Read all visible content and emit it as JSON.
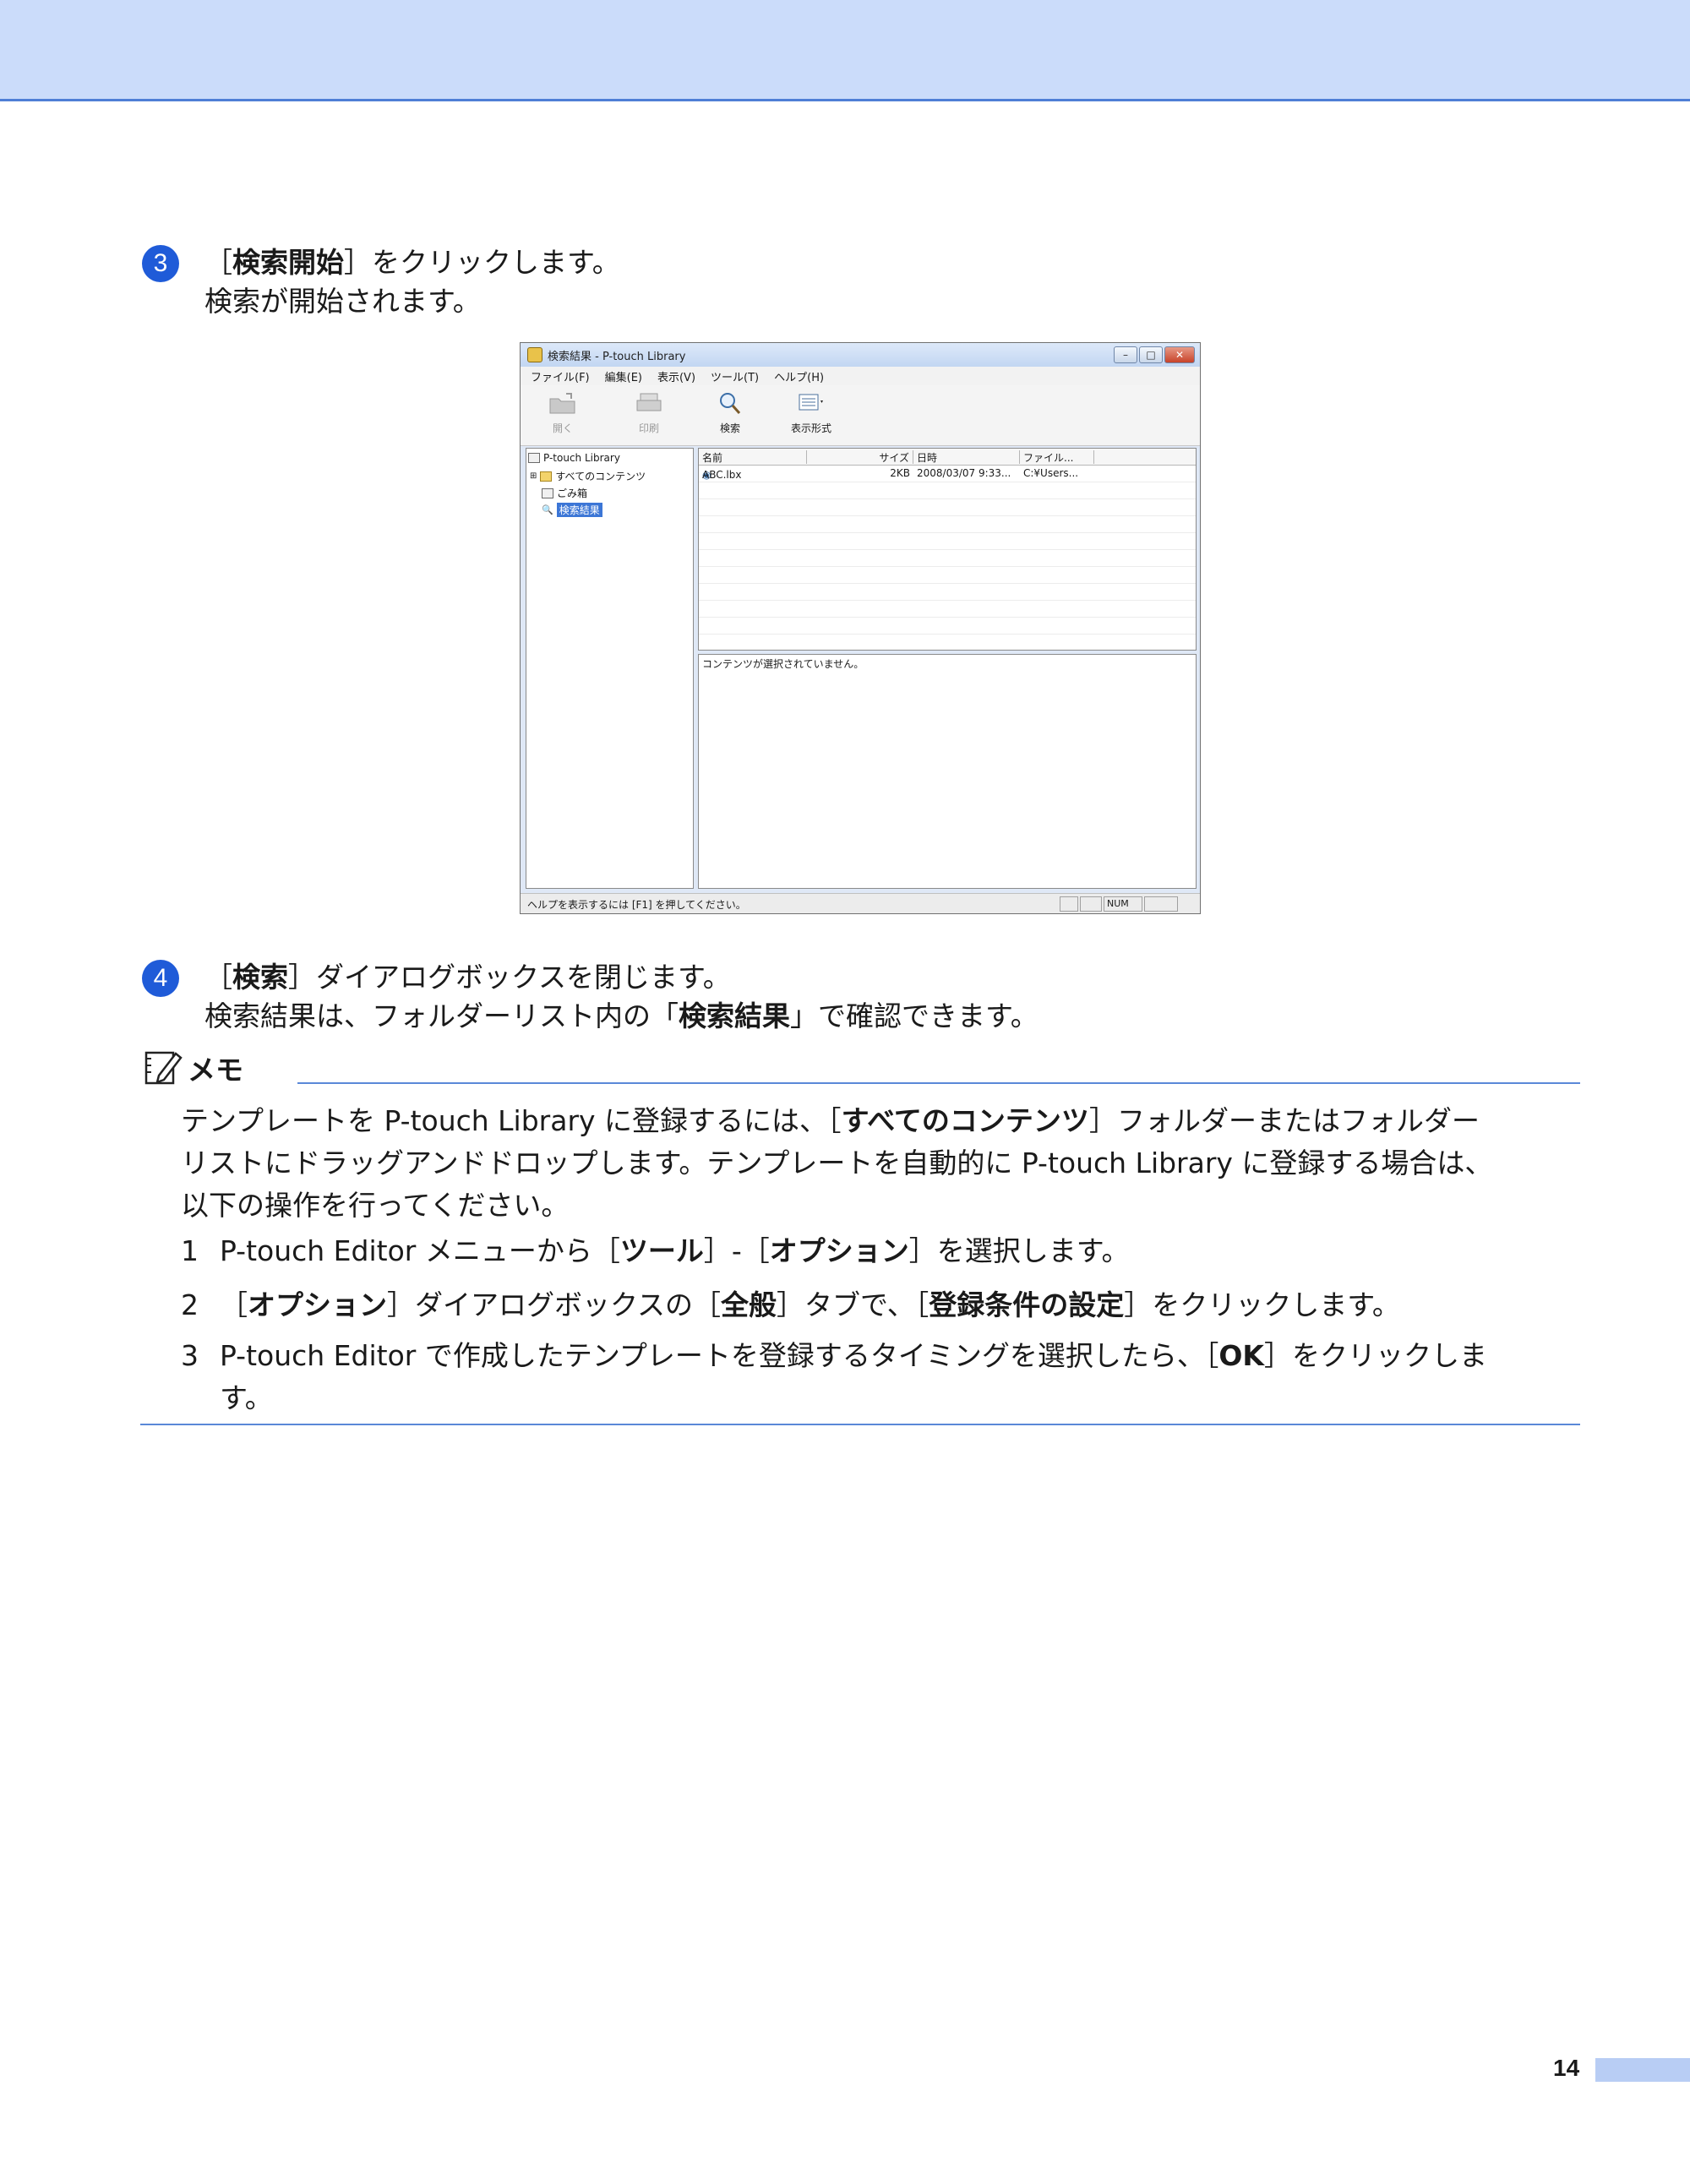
{
  "colors": {
    "accent": "#1f5bd8",
    "band": "#cbdcfa",
    "rule": "#5a88d8"
  },
  "step3": {
    "num": "3",
    "line1_pre": "［",
    "line1_bold": "検索開始",
    "line1_post": "］をクリックします。",
    "line2": "検索が開始されます。"
  },
  "window": {
    "title": "検索結果 - P-touch Library",
    "menus": [
      "ファイル(F)",
      "編集(E)",
      "表示(V)",
      "ツール(T)",
      "ヘルプ(H)"
    ],
    "tools": [
      "開く",
      "印刷",
      "検索",
      "表示形式"
    ],
    "tree": {
      "root": "P-touch Library",
      "all": "すべてのコンテンツ",
      "trash": "ごみ箱",
      "search": "検索結果"
    },
    "columns": [
      "名前",
      "サイズ",
      "日時",
      "ファイル..."
    ],
    "rows": [
      {
        "name": "ABC.lbx",
        "size": "2KB",
        "date": "2008/03/07 9:33...",
        "path": "C:¥Users..."
      }
    ],
    "preview_text": "コンテンツが選択されていません。",
    "status_text": "ヘルプを表示するには [F1] を押してください。",
    "status_num": "NUM"
  },
  "step4": {
    "num": "4",
    "line1_pre": "［",
    "line1_bold": "検索",
    "line1_post": "］ダイアログボックスを閉じます。",
    "line2_pre": "検索結果は、フォルダーリスト内の「",
    "line2_bold": "検索結果",
    "line2_post": "」で確認できます。"
  },
  "memo": {
    "title": "メモ",
    "para_line1_pre": "テンプレートを P-touch Library に登録するには、［",
    "para_line1_bold": "すべてのコンテンツ",
    "para_line1_post": "］フォルダーまたはフォルダー",
    "para_line2": "リストにドラッグアンドドロップします。テンプレートを自動的に P-touch Library に登録する場合は、",
    "para_line3": "以下の操作を行ってください。",
    "items": [
      {
        "n": "1",
        "a": "P-touch Editor メニューから［",
        "b1": "ツール",
        "c": "］-［",
        "b2": "オプション",
        "d": "］を選択します。"
      },
      {
        "n": "2",
        "a": "［",
        "b1": "オプション",
        "c": "］ダイアログボックスの［",
        "b2": "全般",
        "d": "］タブで、［",
        "b3": "登録条件の設定",
        "e": "］をクリックします。"
      },
      {
        "n": "3",
        "a": "P-touch Editor で作成したテンプレートを登録するタイミングを選択したら、［",
        "b1": "OK",
        "c": "］をクリックしま",
        "d": "す。"
      }
    ]
  },
  "page_number": "14"
}
